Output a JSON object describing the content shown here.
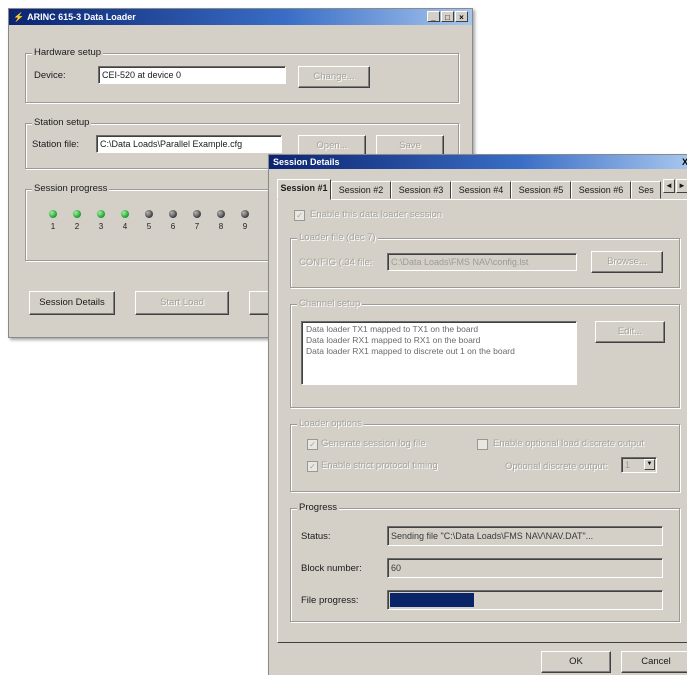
{
  "main_window": {
    "title": "ARINC 615-3 Data Loader",
    "icon": "app-icon",
    "hardware_setup": {
      "legend": "Hardware setup",
      "device_label": "Device:",
      "device_value": "CEI-520 at device 0",
      "change_button": "Change..."
    },
    "station_setup": {
      "legend": "Station setup",
      "station_file_label": "Station file:",
      "station_file_value": "C:\\Data Loads\\Parallel Example.cfg",
      "open_button": "Open...",
      "save_button": "Save"
    },
    "session_progress": {
      "legend": "Session progress",
      "leds": [
        {
          "num": "1",
          "state": "on"
        },
        {
          "num": "2",
          "state": "on"
        },
        {
          "num": "3",
          "state": "on"
        },
        {
          "num": "4",
          "state": "on"
        },
        {
          "num": "5",
          "state": "off"
        },
        {
          "num": "6",
          "state": "off"
        },
        {
          "num": "7",
          "state": "off"
        },
        {
          "num": "8",
          "state": "off"
        },
        {
          "num": "9",
          "state": "off"
        }
      ]
    },
    "session_details_button": "Session Details",
    "start_load_button": "Start Load"
  },
  "session_window": {
    "title": "Session Details",
    "close_glyph": "X",
    "tabs": [
      "Session #1",
      "Session #2",
      "Session #3",
      "Session #4",
      "Session #5",
      "Session #6",
      "Ses"
    ],
    "active_tab": 0,
    "enable_checkbox": "Enable this data loader session",
    "loader_file": {
      "legend": "Loader file (dec 7)",
      "label": "CONFIG (.34 file:",
      "value": "C:\\Data Loads\\FMS NAV\\config.lst",
      "browse_button": "Browse..."
    },
    "channel_setup": {
      "legend": "Channel setup",
      "lines": [
        "Data loader TX1 mapped to TX1 on the board",
        "Data loader RX1 mapped to RX1 on the board",
        "Data loader RX1 mapped to discrete out 1 on the board"
      ],
      "edit_button": "Edit..."
    },
    "loader_options": {
      "legend": "Loader options",
      "generate_log": "Generate session log file",
      "enable_discrete": "Enable optional load discrete output",
      "enable_timing": "Enable strict protocol timing",
      "discrete_label": "Optional discrete output:",
      "discrete_value": "1"
    },
    "progress": {
      "legend": "Progress",
      "status_label": "Status:",
      "status_value": "Sending file \"C:\\Data Loads\\FMS NAV\\NAV.DAT\"...",
      "block_label": "Block number:",
      "block_value": "60",
      "file_progress_label": "File progress:",
      "file_progress_fraction": 0.32
    },
    "ok_button": "OK",
    "cancel_button": "Cancel"
  },
  "colors": {
    "title_start": "#0b2470",
    "title_end": "#a6c6ee",
    "face": "#d4d0c8",
    "progress_fill": "#0a246a"
  }
}
